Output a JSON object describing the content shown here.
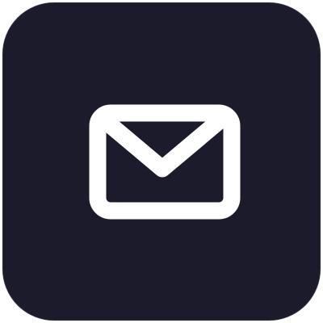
{
  "app_icon": {
    "icon": "mail-icon",
    "background_color": "#1b1b2b",
    "glyph_color": "#ffffff"
  }
}
